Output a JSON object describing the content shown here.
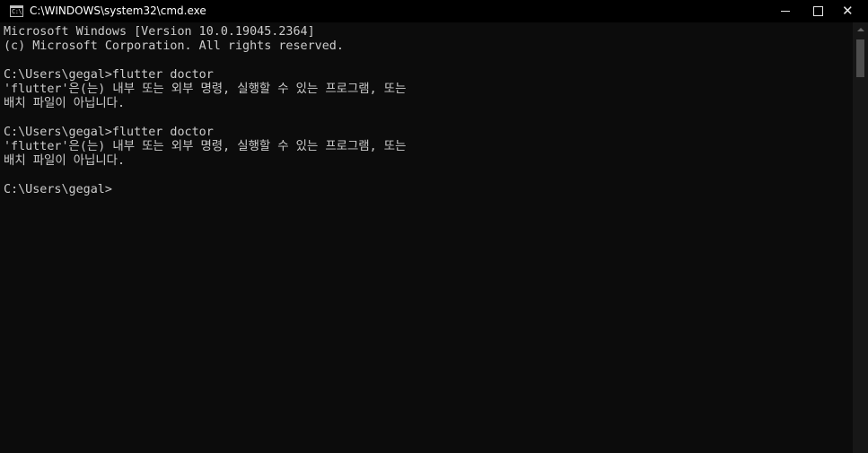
{
  "window": {
    "title": "C:\\WINDOWS\\system32\\cmd.exe",
    "icon_glyph": "C:\\"
  },
  "console": {
    "lines": [
      "Microsoft Windows [Version 10.0.19045.2364]",
      "(c) Microsoft Corporation. All rights reserved.",
      "",
      "C:\\Users\\gegal>flutter doctor",
      "'flutter'은(는) 내부 또는 외부 명령, 실행할 수 있는 프로그램, 또는",
      "배치 파일이 아닙니다.",
      "",
      "C:\\Users\\gegal>flutter doctor",
      "'flutter'은(는) 내부 또는 외부 명령, 실행할 수 있는 프로그램, 또는",
      "배치 파일이 아닙니다.",
      "",
      "C:\\Users\\gegal>"
    ]
  },
  "colors": {
    "background": "#0c0c0c",
    "titlebar": "#000000",
    "text": "#cccccc"
  },
  "icons": {
    "app": "cmd-icon",
    "minimize": "minimize-icon",
    "maximize": "maximize-icon",
    "close": "close-icon",
    "scroll_up": "arrow-up-icon"
  }
}
